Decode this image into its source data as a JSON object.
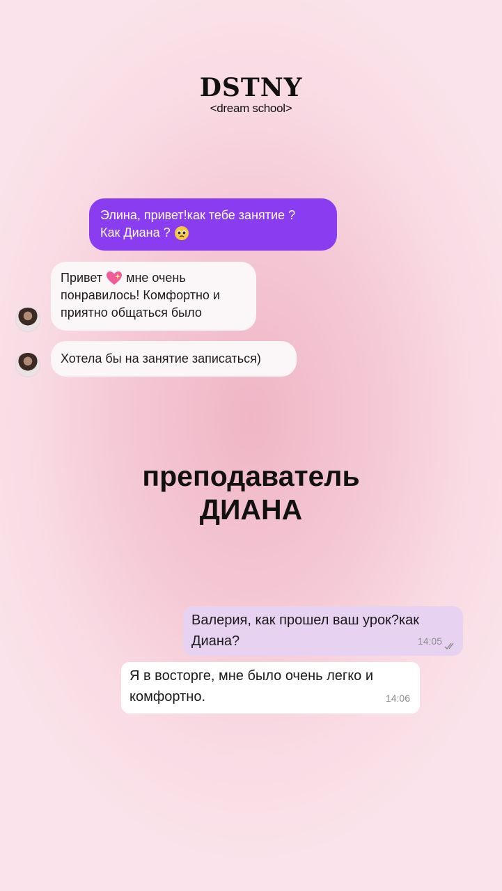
{
  "logo": {
    "title": "DSTNY",
    "subtitle": "<dream school>"
  },
  "chat1": {
    "msg_sent": {
      "line1": "Элина, привет!как тебе занятие ?",
      "line2": "Как Диана ?"
    },
    "msg_reply1": {
      "prefix": "Привет",
      "rest": "мне очень",
      "line2": "понравилось! Комфортно и",
      "line3": "приятно общаться было"
    },
    "msg_reply2": "Хотела бы на занятие записаться)"
  },
  "heading": {
    "line1": "преподаватель",
    "line2": "ДИАНА"
  },
  "chat2": {
    "sent": {
      "text": "Валерия, как прошел ваш урок?как Диана?",
      "time": "14:05"
    },
    "received": {
      "text": "Я в восторге, мне было очень легко и комфортно.",
      "time": "14:06"
    }
  },
  "colors": {
    "purple_bubble": "#8a3cf0",
    "sent_bubble": "#e7d3f1",
    "received_bubble": "#ffffff",
    "read_ticks": "#8a8a8a"
  },
  "icons": [
    "pleading-face-emoji",
    "sparkling-heart-emoji",
    "avatar-photo",
    "double-check-icon"
  ]
}
